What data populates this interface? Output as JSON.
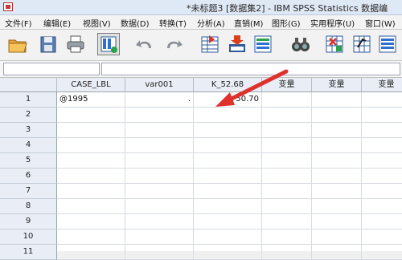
{
  "window": {
    "title": "*未标题3 [数据集2] - IBM SPSS Statistics 数据编"
  },
  "menu": [
    "文件(F)",
    "编辑(E)",
    "视图(V)",
    "数据(D)",
    "转换(T)",
    "分析(A)",
    "直销(M)",
    "图形(G)",
    "实用程序(U)",
    "窗口(W)"
  ],
  "toolbar": {
    "icons": [
      "open-folder-icon",
      "save-icon",
      "print-icon",
      "dialog-recall-icon",
      "undo-icon",
      "redo-icon",
      "goto-case-icon",
      "goto-variable-icon",
      "variables-icon",
      "find-icon",
      "insert-cases-icon",
      "insert-variable-icon",
      "split-file-icon",
      "select-cases-icon"
    ]
  },
  "cell_editor": {
    "name": "",
    "value": ""
  },
  "columns": [
    "CASE_LBL",
    "var001",
    "K_52.68",
    "变量",
    "变量",
    "变量"
  ],
  "rows": [
    {
      "num": "1",
      "cells": [
        "@1995",
        ".",
        "50.70",
        "",
        "",
        ""
      ]
    },
    {
      "num": "2",
      "cells": [
        "",
        "",
        "",
        "",
        "",
        ""
      ]
    },
    {
      "num": "3",
      "cells": [
        "",
        "",
        "",
        "",
        "",
        ""
      ]
    },
    {
      "num": "4",
      "cells": [
        "",
        "",
        "",
        "",
        "",
        ""
      ]
    },
    {
      "num": "5",
      "cells": [
        "",
        "",
        "",
        "",
        "",
        ""
      ]
    },
    {
      "num": "6",
      "cells": [
        "",
        "",
        "",
        "",
        "",
        ""
      ]
    },
    {
      "num": "7",
      "cells": [
        "",
        "",
        "",
        "",
        "",
        ""
      ]
    },
    {
      "num": "8",
      "cells": [
        "",
        "",
        "",
        "",
        "",
        ""
      ]
    },
    {
      "num": "9",
      "cells": [
        "",
        "",
        "",
        "",
        "",
        ""
      ]
    },
    {
      "num": "10",
      "cells": [
        "",
        "",
        "",
        "",
        "",
        ""
      ]
    },
    {
      "num": "11",
      "cells": [
        "",
        "",
        "",
        "",
        "",
        ""
      ]
    }
  ],
  "colors": {
    "annotation_arrow": "#e0302c",
    "header_bg": "#e9eef6"
  }
}
